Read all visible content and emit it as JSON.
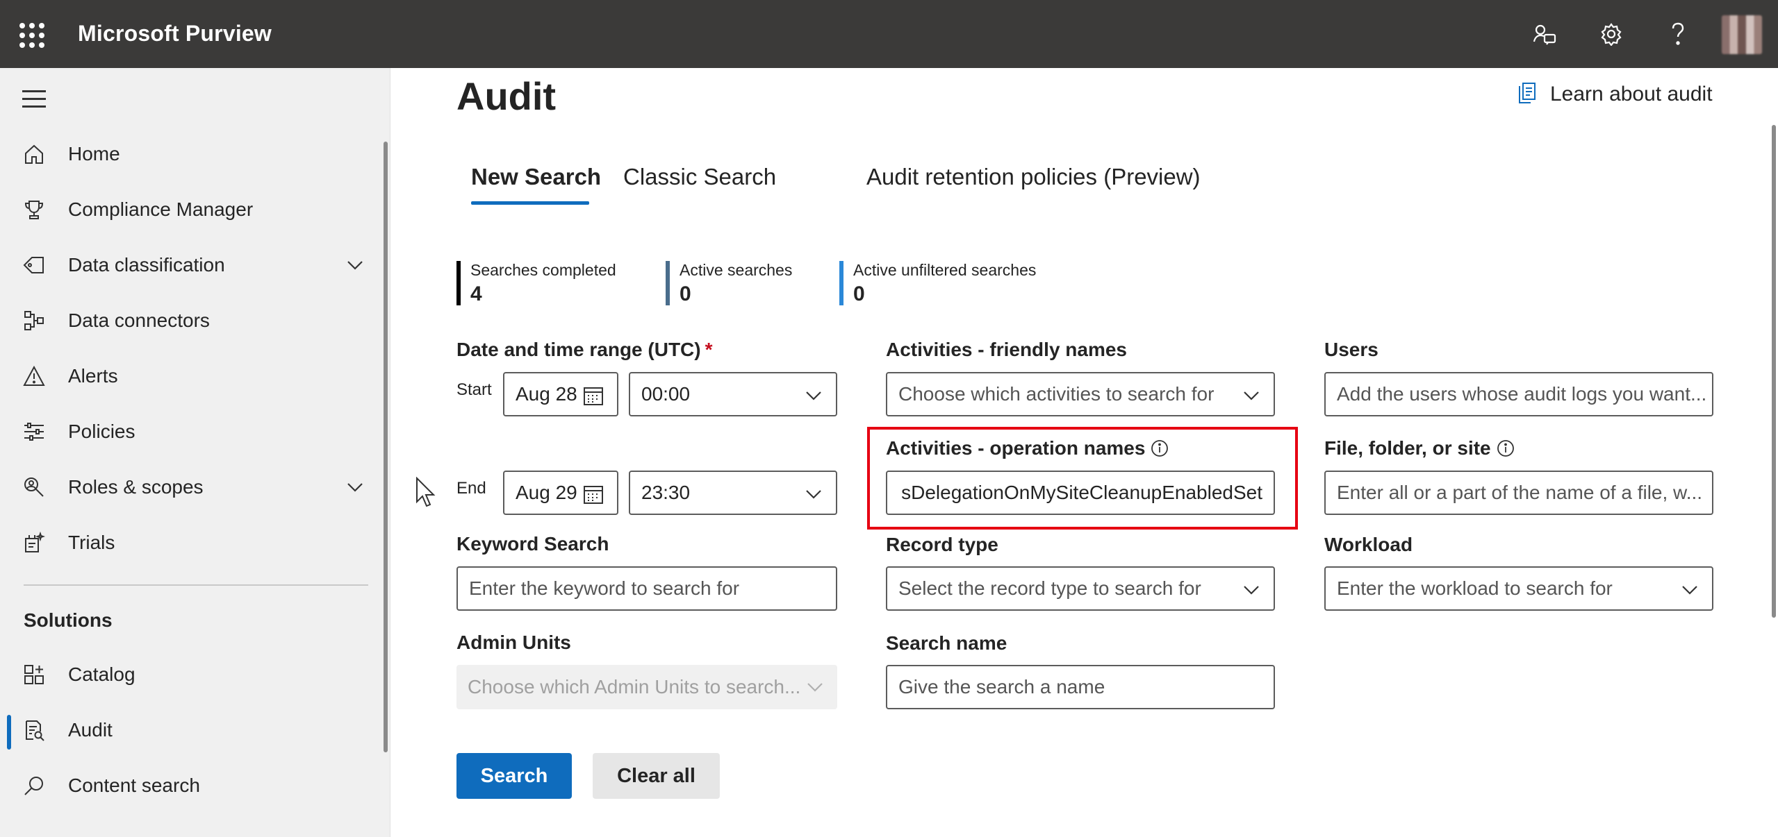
{
  "app": {
    "name": "Microsoft Purview"
  },
  "topbar": {
    "icons": [
      "community-icon",
      "settings-icon",
      "help-icon",
      "avatar"
    ]
  },
  "sidebar": {
    "items": [
      {
        "label": "Home",
        "icon": "home-icon"
      },
      {
        "label": "Compliance Manager",
        "icon": "trophy-icon"
      },
      {
        "label": "Data classification",
        "icon": "tag-icon",
        "expandable": true
      },
      {
        "label": "Data connectors",
        "icon": "connector-icon"
      },
      {
        "label": "Alerts",
        "icon": "alert-icon"
      },
      {
        "label": "Policies",
        "icon": "sliders-icon"
      },
      {
        "label": "Roles & scopes",
        "icon": "search-person-icon",
        "expandable": true
      },
      {
        "label": "Trials",
        "icon": "trials-icon"
      }
    ],
    "section_title": "Solutions",
    "solutions": [
      {
        "label": "Catalog",
        "icon": "catalog-icon"
      },
      {
        "label": "Audit",
        "icon": "audit-icon",
        "selected": true
      },
      {
        "label": "Content search",
        "icon": "search-icon"
      }
    ]
  },
  "page": {
    "title": "Audit",
    "learn_link": "Learn about audit",
    "tabs": [
      {
        "label": "New Search",
        "selected": true
      },
      {
        "label": "Classic Search"
      },
      {
        "label": "Audit retention policies (Preview)"
      }
    ],
    "stats": [
      {
        "label": "Searches completed",
        "value": "4",
        "color": "#000000"
      },
      {
        "label": "Active searches",
        "value": "0",
        "color": "#4a6d8c"
      },
      {
        "label": "Active unfiltered searches",
        "value": "0",
        "color": "#2b88d8"
      }
    ]
  },
  "form": {
    "date_range": {
      "label": "Date and time range (UTC)",
      "required_mark": "*",
      "start_label": "Start",
      "start_date": "Aug 28",
      "start_time": "00:00",
      "end_label": "End",
      "end_date": "Aug 29",
      "end_time": "23:30"
    },
    "activities_friendly": {
      "label": "Activities - friendly names",
      "placeholder": "Choose which activities to search for"
    },
    "activities_operation": {
      "label": "Activities - operation names",
      "value": "sDelegationOnMySiteCleanupEnabledSet"
    },
    "users": {
      "label": "Users",
      "placeholder": "Add the users whose audit logs you want..."
    },
    "file_folder_site": {
      "label": "File, folder, or site",
      "placeholder": "Enter all or a part of the name of a file, w..."
    },
    "keyword": {
      "label": "Keyword Search",
      "placeholder": "Enter the keyword to search for"
    },
    "record_type": {
      "label": "Record type",
      "placeholder": "Select the record type to search for"
    },
    "workload": {
      "label": "Workload",
      "placeholder": "Enter the workload to search for"
    },
    "admin_units": {
      "label": "Admin Units",
      "placeholder": "Choose which Admin Units to search..."
    },
    "search_name": {
      "label": "Search name",
      "placeholder": "Give the search a name"
    },
    "buttons": {
      "search": "Search",
      "clear": "Clear all"
    }
  }
}
